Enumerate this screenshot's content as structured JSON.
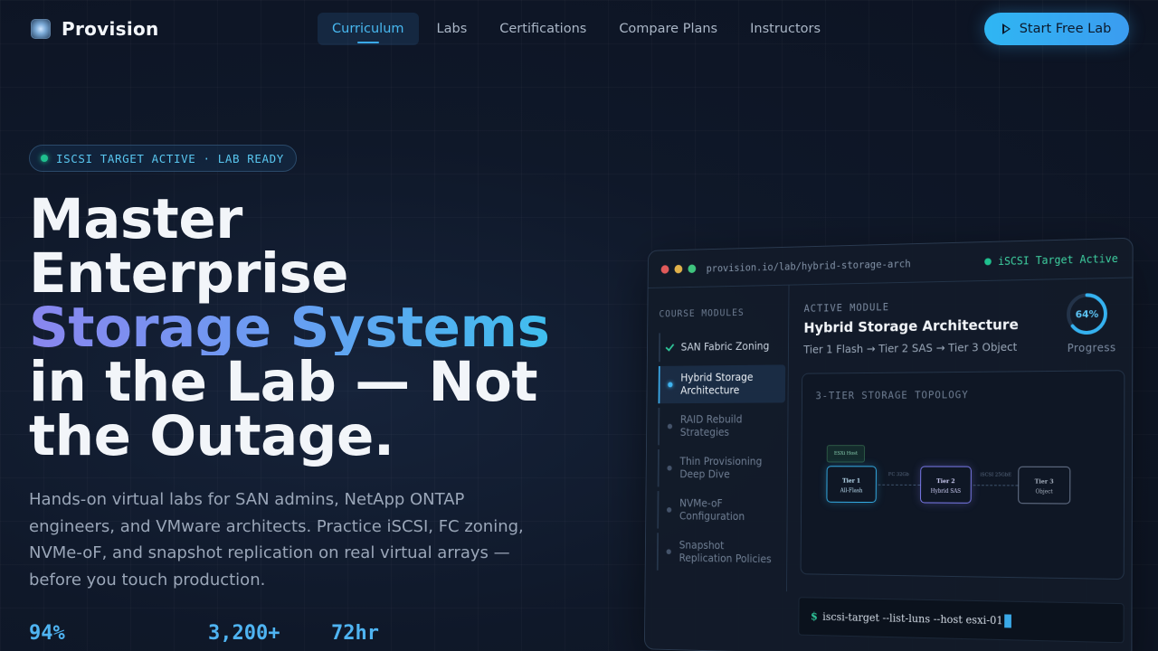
{
  "nav": {
    "brand": "Provision",
    "links": [
      "Curriculum",
      "Labs",
      "Certifications",
      "Compare Plans",
      "Instructors"
    ],
    "active_link": "Curriculum",
    "cta": "Start Free Lab"
  },
  "hero": {
    "badge": "ISCSI TARGET ACTIVE · LAB READY",
    "headline_line1": "Master",
    "headline_line2": "Enterprise",
    "headline_highlight": "Storage Systems",
    "headline_line4": "in the Lab — Not",
    "headline_line5": "the Outage.",
    "subtext": "Hands-on virtual labs for SAN admins, NetApp ONTAP engineers, and VMware architects. Practice iSCSI, FC zoning, NVMe-oF, and snapshot replication on real virtual arrays — before you touch production.",
    "stats": [
      "94%",
      "3,200+",
      "72hr"
    ]
  },
  "lab": {
    "url": "provision.io/lab/hybrid-storage-arch",
    "status": "iSCSI Target Active",
    "sidebar_title": "COURSE MODULES",
    "modules": [
      {
        "label": "SAN Fabric Zoning",
        "state": "done"
      },
      {
        "label": "Hybrid Storage Architecture",
        "state": "active"
      },
      {
        "label": "RAID Rebuild Strategies",
        "state": "pending"
      },
      {
        "label": "Thin Provisioning Deep Dive",
        "state": "pending"
      },
      {
        "label": "NVMe-oF Configuration",
        "state": "pending"
      },
      {
        "label": "Snapshot Replication Policies",
        "state": "pending"
      }
    ],
    "active_label": "ACTIVE MODULE",
    "active_title": "Hybrid Storage Architecture",
    "active_sub": "Tier 1 Flash → Tier 2 SAS → Tier 3 Object",
    "progress_pct": "64%",
    "progress_value": 0.64,
    "progress_label": "Progress",
    "topology": {
      "title": "3-TIER STORAGE TOPOLOGY",
      "host": "ESXi Host",
      "tiers": [
        {
          "name": "Tier 1",
          "media": "All-Flash"
        },
        {
          "name": "Tier 2",
          "media": "Hybrid SAS"
        },
        {
          "name": "Tier 3",
          "media": "Object"
        }
      ],
      "links": [
        "FC 32Gb",
        "iSCSI 25GbE"
      ]
    },
    "terminal": {
      "prompt": "$",
      "command": "iscsi-target --list-luns --host esxi-01"
    }
  },
  "colors": {
    "accent": "#3aa9e8",
    "success": "#1fc08e",
    "violet": "#7d7cf0"
  }
}
